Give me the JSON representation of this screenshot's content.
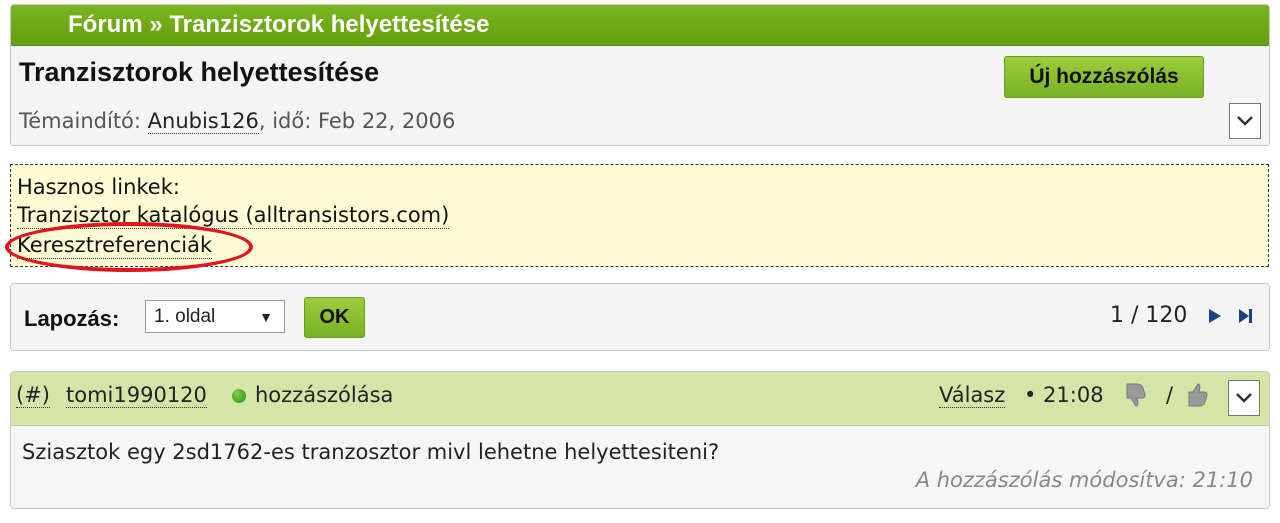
{
  "breadcrumb": {
    "text": "Fórum » Tranzisztorok helyettesítése"
  },
  "topic": {
    "title": "Tranzisztorok helyettesítése",
    "new_post_label": "Új hozzászólás",
    "starter_prefix": "Témaindító: ",
    "starter_user": "Anubis126",
    "starter_suffix": ", idő: Feb 22, 2006"
  },
  "useful_links": {
    "heading": "Hasznos linkek:",
    "items": [
      {
        "label": "Tranzisztor katalógus (alltransistors.com)"
      },
      {
        "label": "Keresztreferenciák"
      }
    ]
  },
  "pagination": {
    "label": "Lapozás:",
    "selected_page": "1. oldal",
    "ok_label": "OK",
    "page_count": "1 / 120"
  },
  "post": {
    "permalink": "(#)",
    "author": "tomi1990120",
    "author_suffix": "hozzászólása",
    "reply_label": "Válasz",
    "time": "• 21:08",
    "vote_separator": "/",
    "body": "Sziasztok egy 2sd1762-es tranzosztor mivl lehetne helyettesiteni?",
    "edited_note": "A hozzászólás módosítva: 21:10"
  },
  "colors": {
    "header_green": "#6ea818",
    "button_green": "#8cc032",
    "post_header_green": "#d3e6a8",
    "links_bg": "#fefcd4",
    "highlight_red": "#e0141e",
    "online_green": "#3a9a1a"
  },
  "icons": {
    "dropdown": "chevron-down-icon",
    "next_page": "play-next-icon",
    "last_page": "skip-last-icon",
    "thumbs_down": "thumbs-down-icon",
    "thumbs_up": "thumbs-up-icon",
    "online": "online-status-icon"
  }
}
